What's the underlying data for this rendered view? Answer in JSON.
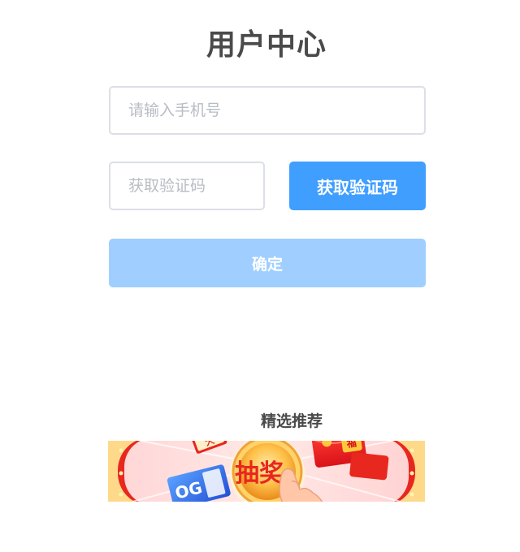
{
  "page": {
    "title": "用户中心"
  },
  "form": {
    "phone_placeholder": "请输入手机号",
    "code_placeholder": "获取验证码",
    "get_code_label": "获取验证码",
    "confirm_label": "确定"
  },
  "recommend": {
    "title": "精选推荐",
    "banner": {
      "button_text": "抽奖",
      "ticket_text": "大",
      "card_text": "OG",
      "envelope_text": "福"
    }
  },
  "colors": {
    "primary": "#409eff",
    "primary_disabled": "#a0cfff",
    "border": "#dcdfe6",
    "title_text": "#4a4a4a",
    "placeholder": "#b8bcc4"
  }
}
